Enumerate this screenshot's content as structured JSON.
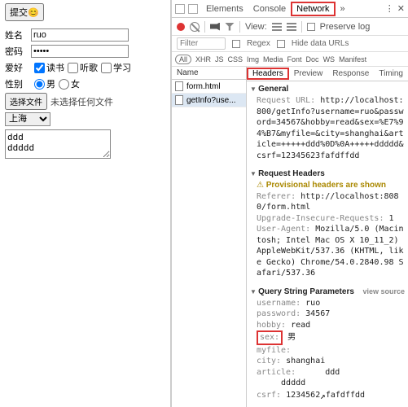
{
  "form": {
    "submit_label": "提交😊",
    "name_label": "姓名",
    "name_value": "ruo",
    "pwd_label": "密码",
    "pwd_value": "•••••",
    "hobby_label": "爱好",
    "hobby_read": "读书",
    "hobby_music": "听歌",
    "hobby_study": "学习",
    "sex_label": "性别",
    "sex_male": "男",
    "sex_female": "女",
    "file_btn": "选择文件",
    "file_none": "未选择任何文件",
    "city_value": "上海",
    "textarea_value": "ddd\nddddd"
  },
  "devtools": {
    "tabs": {
      "elements": "Elements",
      "console": "Console",
      "network": "Network"
    },
    "toolbar": {
      "view": "View:",
      "preserve": "Preserve log"
    },
    "filter": {
      "placeholder": "Filter",
      "regex": "Regex",
      "hide": "Hide data URLs"
    },
    "types": [
      "All",
      "XHR",
      "JS",
      "CSS",
      "Img",
      "Media",
      "Font",
      "Doc",
      "WS",
      "Manifest"
    ],
    "name_header": "Name",
    "detail_tabs": {
      "headers": "Headers",
      "preview": "Preview",
      "response": "Response",
      "timing": "Timing"
    },
    "requests": [
      {
        "name": "form.html"
      },
      {
        "name": "getInfo?use..."
      }
    ]
  },
  "headers": {
    "general_title": "General",
    "request_url_k": "Request URL:",
    "request_url_v": "http://localhost:800/getInfo?username=ruo&password=34567&hobby=read&sex=%E7%94%B7&myfile=&city=shanghai&article=+++++ddd%0D%0A+++++ddddd&csrf=12345623fafdffdd",
    "req_headers_title": "Request Headers",
    "provisional": "Provisional headers are shown",
    "referer_k": "Referer:",
    "referer_v": "http://localhost:8080/form.html",
    "upgrade_k": "Upgrade-Insecure-Requests:",
    "upgrade_v": "1",
    "ua_k": "User-Agent:",
    "ua_v": "Mozilla/5.0 (Macintosh; Intel Mac OS X 10_11_2) AppleWebKit/537.36 (KHTML, like Gecko) Chrome/54.0.2840.98 Safari/537.36",
    "qs_title": "Query String Parameters",
    "view_source": "view source",
    "params": {
      "username_k": "username:",
      "username_v": "ruo",
      "password_k": "password:",
      "password_v": "34567",
      "hobby_k": "hobby:",
      "hobby_v": "read",
      "sex_k": "sex:",
      "sex_v": "男",
      "myfile_k": "myfile:",
      "myfile_v": "",
      "city_k": "city:",
      "city_v": "shanghai",
      "article_k": "article:",
      "article_v": "     ddd\n     ddddd",
      "csrf_k": "csrf:",
      "csrf_v_a": "1234562",
      "csrf_v_b": "fafdffdd"
    }
  }
}
